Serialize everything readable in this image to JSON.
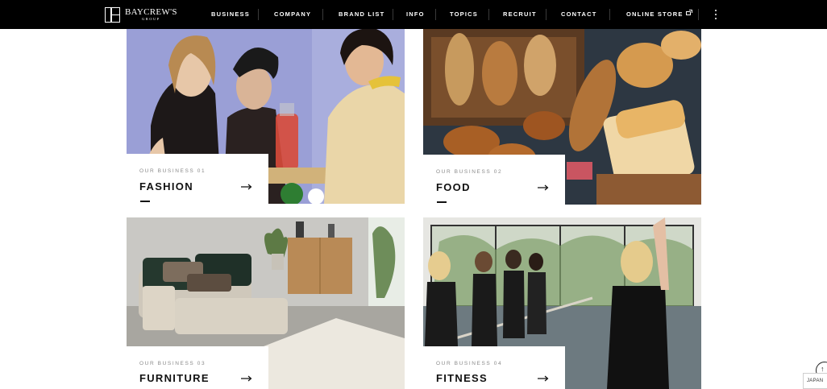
{
  "header": {
    "logo": {
      "name": "BAYCREW'S",
      "sub": "GROUP"
    },
    "nav": [
      {
        "label": "BUSINESS"
      },
      {
        "label": "COMPANY"
      },
      {
        "label": "BRAND LIST"
      },
      {
        "label": "INFO"
      },
      {
        "label": "TOPICS"
      },
      {
        "label": "RECRUIT"
      },
      {
        "label": "CONTACT"
      },
      {
        "label": "ONLINE STORE",
        "icon": "external-link-icon"
      }
    ],
    "menu_icon": "vertical-dots-menu-icon"
  },
  "businesses": [
    {
      "kicker": "OUR BUSINESS 01",
      "title": "FASHION",
      "image": "fashion-photo",
      "active": true
    },
    {
      "kicker": "OUR BUSINESS 02",
      "title": "FOOD",
      "image": "food-photo",
      "active": true
    },
    {
      "kicker": "OUR BUSINESS 03",
      "title": "FURNITURE",
      "image": "furniture-photo",
      "active": false
    },
    {
      "kicker": "OUR BUSINESS 04",
      "title": "FITNESS",
      "image": "fitness-photo",
      "active": false
    }
  ],
  "widgets": {
    "scroll_top_icon": "arrow-up-icon",
    "language": "JAPAN"
  },
  "colors": {
    "header_bg": "#000000",
    "text": "#111111",
    "kicker": "#8a8a8a",
    "background": "#ffffff"
  }
}
